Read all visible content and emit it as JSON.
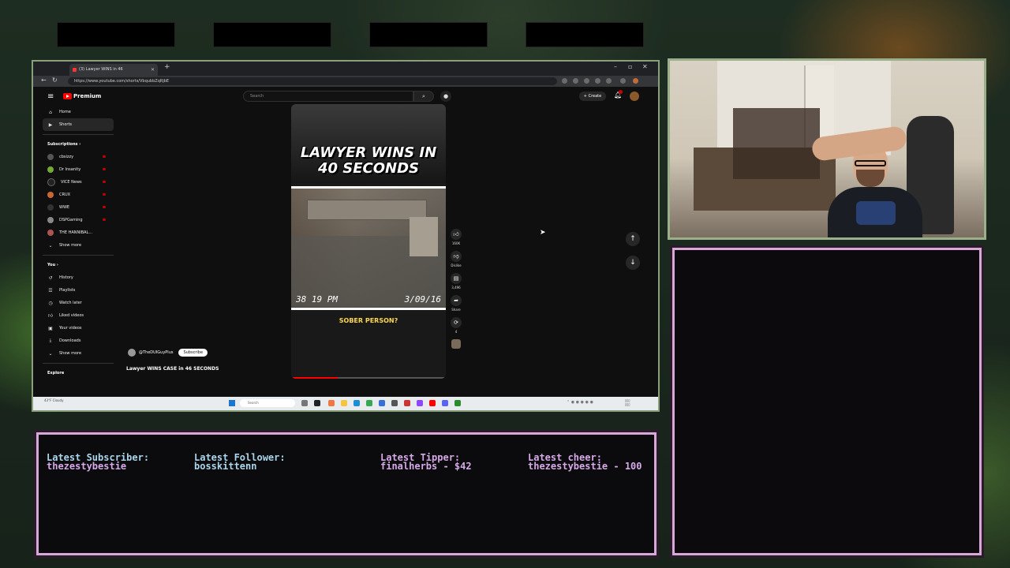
{
  "browser": {
    "tab_title": "(3) Lawyer WINS in 46",
    "url": "https://www.youtube.com/shorts/VbqubbZqRjbE"
  },
  "youtube": {
    "logo": "Premium",
    "search_placeholder": "Search",
    "create_label": "+ Create",
    "sidebar": {
      "main": [
        {
          "label": "Home",
          "icon": "home-icon"
        },
        {
          "label": "Shorts",
          "icon": "shorts-icon"
        }
      ],
      "subscriptions_header": "Subscriptions",
      "subscriptions": [
        {
          "label": "cbsizzy"
        },
        {
          "label": "Dr Insanity"
        },
        {
          "label": "VICE News"
        },
        {
          "label": "CRUX"
        },
        {
          "label": "WWE"
        },
        {
          "label": "DSPGaming"
        },
        {
          "label": "THE HANNIBAL..."
        }
      ],
      "show_more": "Show more",
      "you_header": "You",
      "you_items": [
        {
          "label": "History",
          "icon": "history-icon"
        },
        {
          "label": "Playlists",
          "icon": "playlists-icon"
        },
        {
          "label": "Watch later",
          "icon": "clock-icon"
        },
        {
          "label": "Liked videos",
          "icon": "thumbs-up-icon"
        },
        {
          "label": "Your videos",
          "icon": "video-icon"
        },
        {
          "label": "Downloads",
          "icon": "download-icon"
        }
      ],
      "show_more_2": "Show more",
      "explore_header": "Explore"
    },
    "short": {
      "overlay_title": "LAWYER WINS IN 40 SECONDS",
      "timestamp_left": "38 19 PM",
      "timestamp_right": "3/09/16",
      "caption": "SOBER PERSON?",
      "channel": "@TheDUIGuyPlus",
      "subscribe_label": "Subscribe",
      "video_title": "Lawyer WINS CASE in 46 SECONDS",
      "progress": 0.3
    },
    "actions": {
      "like_count": "160K",
      "dislike_label": "Dislike",
      "comment_count": "3,496",
      "share_label": "Share",
      "remix_count": "4"
    }
  },
  "taskbar": {
    "weather": "43°F Cloudy",
    "search_placeholder": "Search"
  },
  "stream_alerts": [
    {
      "label": "Latest Subscriber:",
      "value": "thezestybestie"
    },
    {
      "label": "Latest Follower:",
      "value": "bosskittenn"
    },
    {
      "label": "Latest Tipper:",
      "value": "finalherbs - $42"
    },
    {
      "label": "Latest cheer:",
      "value": "thezestybestie - 100"
    }
  ],
  "colors": {
    "frame_border": "#d8a8d8",
    "alert_label": "#a9d6ec",
    "alert_value": "#d6a9e8",
    "yt_red": "#ff0000",
    "caption_yellow": "#ffd84d"
  }
}
